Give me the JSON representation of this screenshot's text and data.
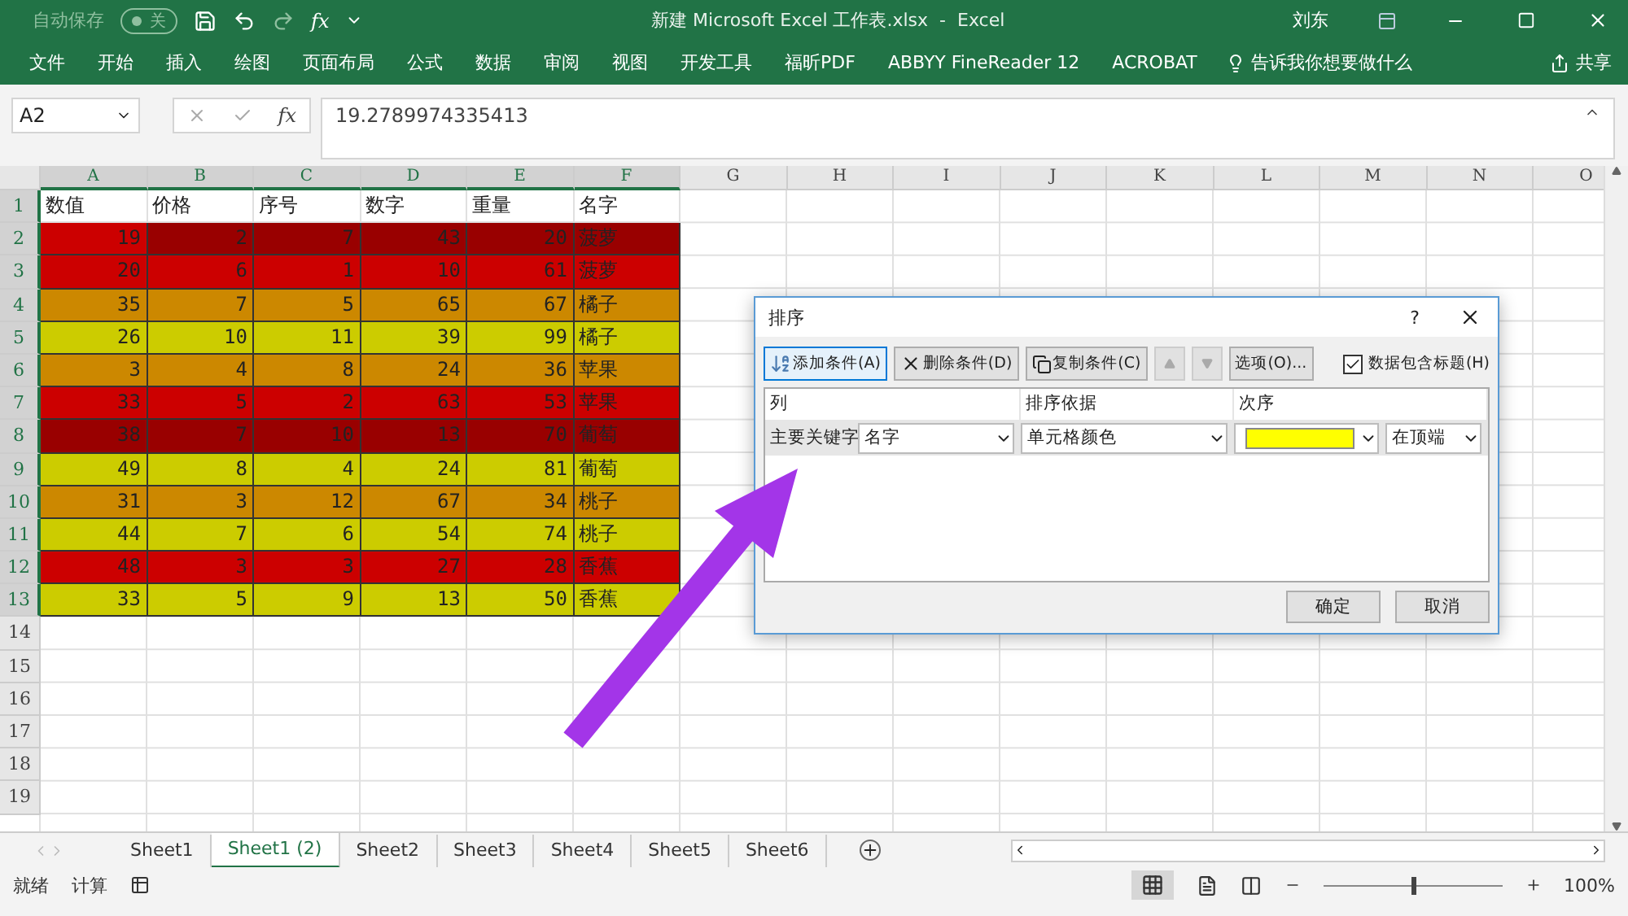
{
  "title_bar": {
    "autosave_label": "自动保存",
    "autosave_state": "关",
    "title": "新建 Microsoft Excel 工作表.xlsx  -  Excel",
    "user": "刘东"
  },
  "ribbon_tabs": [
    "文件",
    "开始",
    "插入",
    "绘图",
    "页面布局",
    "公式",
    "数据",
    "审阅",
    "视图",
    "开发工具",
    "福昕PDF",
    "ABBYY FineReader 12",
    "ACROBAT"
  ],
  "tell_me": "告诉我你想要做什么",
  "share": "共享",
  "quick_access_fx": "fx",
  "formula_bar": {
    "name_box": "A2",
    "fx": "fx",
    "value": "19.2789974335413"
  },
  "sheet": {
    "columns": [
      {
        "label": "A",
        "selected": true
      },
      {
        "label": "B",
        "selected": true
      },
      {
        "label": "C",
        "selected": true
      },
      {
        "label": "D",
        "selected": true
      },
      {
        "label": "E",
        "selected": true
      },
      {
        "label": "F",
        "selected": true
      },
      {
        "label": "G",
        "selected": false
      },
      {
        "label": "H",
        "selected": false
      },
      {
        "label": "I",
        "selected": false
      },
      {
        "label": "J",
        "selected": false
      },
      {
        "label": "K",
        "selected": false
      },
      {
        "label": "L",
        "selected": false
      },
      {
        "label": "M",
        "selected": false
      },
      {
        "label": "N",
        "selected": false
      },
      {
        "label": "O",
        "selected": false
      }
    ],
    "rows": [
      {
        "number": "1",
        "selected": true,
        "kind": "header",
        "cells": [
          {
            "text": "数值"
          },
          {
            "text": "价格"
          },
          {
            "text": "序号"
          },
          {
            "text": "数字"
          },
          {
            "text": "重量"
          },
          {
            "text": "名字"
          }
        ]
      },
      {
        "number": "2",
        "selected": true,
        "kind": "data",
        "cells": [
          {
            "text": "19",
            "color": "#cc0000"
          },
          {
            "text": "2",
            "color": "#990000"
          },
          {
            "text": "7",
            "color": "#990000"
          },
          {
            "text": "43",
            "color": "#990000"
          },
          {
            "text": "20",
            "color": "#990000"
          },
          {
            "text": "菠萝",
            "color": "#990000"
          }
        ]
      },
      {
        "number": "3",
        "selected": true,
        "kind": "data",
        "cells": [
          {
            "text": "20",
            "color": "#cc0000"
          },
          {
            "text": "6",
            "color": "#cc0000"
          },
          {
            "text": "1",
            "color": "#cc0000"
          },
          {
            "text": "10",
            "color": "#cc0000"
          },
          {
            "text": "61",
            "color": "#cc0000"
          },
          {
            "text": "菠萝",
            "color": "#cc0000"
          }
        ]
      },
      {
        "number": "4",
        "selected": true,
        "kind": "data",
        "cells": [
          {
            "text": "35",
            "color": "#cc8800"
          },
          {
            "text": "7",
            "color": "#cc8800"
          },
          {
            "text": "5",
            "color": "#cc8800"
          },
          {
            "text": "65",
            "color": "#cc8800"
          },
          {
            "text": "67",
            "color": "#cc8800"
          },
          {
            "text": "橘子",
            "color": "#cc8800"
          }
        ]
      },
      {
        "number": "5",
        "selected": true,
        "kind": "data",
        "cells": [
          {
            "text": "26",
            "color": "#cccc00"
          },
          {
            "text": "10",
            "color": "#cccc00"
          },
          {
            "text": "11",
            "color": "#cccc00"
          },
          {
            "text": "39",
            "color": "#cccc00"
          },
          {
            "text": "99",
            "color": "#cccc00"
          },
          {
            "text": "橘子",
            "color": "#cccc00"
          }
        ]
      },
      {
        "number": "6",
        "selected": true,
        "kind": "data",
        "cells": [
          {
            "text": "3",
            "color": "#cc8800"
          },
          {
            "text": "4",
            "color": "#cc8800"
          },
          {
            "text": "8",
            "color": "#cc8800"
          },
          {
            "text": "24",
            "color": "#cc8800"
          },
          {
            "text": "36",
            "color": "#cc8800"
          },
          {
            "text": "苹果",
            "color": "#cc8800"
          }
        ]
      },
      {
        "number": "7",
        "selected": true,
        "kind": "data",
        "cells": [
          {
            "text": "33",
            "color": "#cc0000"
          },
          {
            "text": "5",
            "color": "#cc0000"
          },
          {
            "text": "2",
            "color": "#cc0000"
          },
          {
            "text": "63",
            "color": "#cc0000"
          },
          {
            "text": "53",
            "color": "#cc0000"
          },
          {
            "text": "苹果",
            "color": "#cc0000"
          }
        ]
      },
      {
        "number": "8",
        "selected": true,
        "kind": "data",
        "cells": [
          {
            "text": "38",
            "color": "#990000"
          },
          {
            "text": "7",
            "color": "#990000"
          },
          {
            "text": "10",
            "color": "#990000"
          },
          {
            "text": "13",
            "color": "#990000"
          },
          {
            "text": "70",
            "color": "#990000"
          },
          {
            "text": "葡萄",
            "color": "#990000"
          }
        ]
      },
      {
        "number": "9",
        "selected": true,
        "kind": "data",
        "cells": [
          {
            "text": "49",
            "color": "#cccc00"
          },
          {
            "text": "8",
            "color": "#cccc00"
          },
          {
            "text": "4",
            "color": "#cccc00"
          },
          {
            "text": "24",
            "color": "#cccc00"
          },
          {
            "text": "81",
            "color": "#cccc00"
          },
          {
            "text": "葡萄",
            "color": "#cccc00"
          }
        ]
      },
      {
        "number": "10",
        "selected": true,
        "kind": "data",
        "cells": [
          {
            "text": "31",
            "color": "#cc8800"
          },
          {
            "text": "3",
            "color": "#cc8800"
          },
          {
            "text": "12",
            "color": "#cc8800"
          },
          {
            "text": "67",
            "color": "#cc8800"
          },
          {
            "text": "34",
            "color": "#cc8800"
          },
          {
            "text": "桃子",
            "color": "#cc8800"
          }
        ]
      },
      {
        "number": "11",
        "selected": true,
        "kind": "data",
        "cells": [
          {
            "text": "44",
            "color": "#cccc00"
          },
          {
            "text": "7",
            "color": "#cccc00"
          },
          {
            "text": "6",
            "color": "#cccc00"
          },
          {
            "text": "54",
            "color": "#cccc00"
          },
          {
            "text": "74",
            "color": "#cccc00"
          },
          {
            "text": "桃子",
            "color": "#cccc00"
          }
        ]
      },
      {
        "number": "12",
        "selected": true,
        "kind": "data",
        "cells": [
          {
            "text": "48",
            "color": "#cc0000"
          },
          {
            "text": "3",
            "color": "#cc0000"
          },
          {
            "text": "3",
            "color": "#cc0000"
          },
          {
            "text": "27",
            "color": "#cc0000"
          },
          {
            "text": "28",
            "color": "#cc0000"
          },
          {
            "text": "香蕉",
            "color": "#cc0000"
          }
        ]
      },
      {
        "number": "13",
        "selected": true,
        "kind": "data",
        "cells": [
          {
            "text": "33",
            "color": "#cccc00"
          },
          {
            "text": "5",
            "color": "#cccc00"
          },
          {
            "text": "9",
            "color": "#cccc00"
          },
          {
            "text": "13",
            "color": "#cccc00"
          },
          {
            "text": "50",
            "color": "#cccc00"
          },
          {
            "text": "香蕉",
            "color": "#cccc00"
          }
        ]
      },
      {
        "number": "14",
        "selected": false
      },
      {
        "number": "15",
        "selected": false
      },
      {
        "number": "16",
        "selected": false
      },
      {
        "number": "17",
        "selected": false
      },
      {
        "number": "18",
        "selected": false
      },
      {
        "number": "19",
        "selected": false
      }
    ]
  },
  "dialog": {
    "title": "排序",
    "help": "?",
    "toolbar": [
      {
        "label": "添加条件(A)",
        "kind": "add"
      },
      {
        "label": "删除条件(D)",
        "kind": "delete"
      },
      {
        "label": "复制条件(C)",
        "kind": "copy"
      }
    ],
    "options": "选项(O)...",
    "header_checkbox": {
      "label": "数据包含标题(H)",
      "checked": true
    },
    "columns": [
      "列",
      "排序依据",
      "次序"
    ],
    "levels": [
      {
        "label": "主要关键字",
        "column": "名字",
        "sort_on": "单元格颜色",
        "color": "#ffff00",
        "order": "在顶端"
      }
    ],
    "buttons": [
      "确定",
      "取消"
    ]
  },
  "sheet_tabs": [
    {
      "label": "Sheet1",
      "selected": false
    },
    {
      "label": "Sheet1 (2)",
      "selected": true
    },
    {
      "label": "Sheet2",
      "selected": false
    },
    {
      "label": "Sheet3",
      "selected": false
    },
    {
      "label": "Sheet4",
      "selected": false
    },
    {
      "label": "Sheet5",
      "selected": false
    },
    {
      "label": "Sheet6",
      "selected": false
    }
  ],
  "status": [
    "就绪",
    "计算"
  ],
  "zoom": {
    "label": "100%",
    "level": 0.5
  }
}
